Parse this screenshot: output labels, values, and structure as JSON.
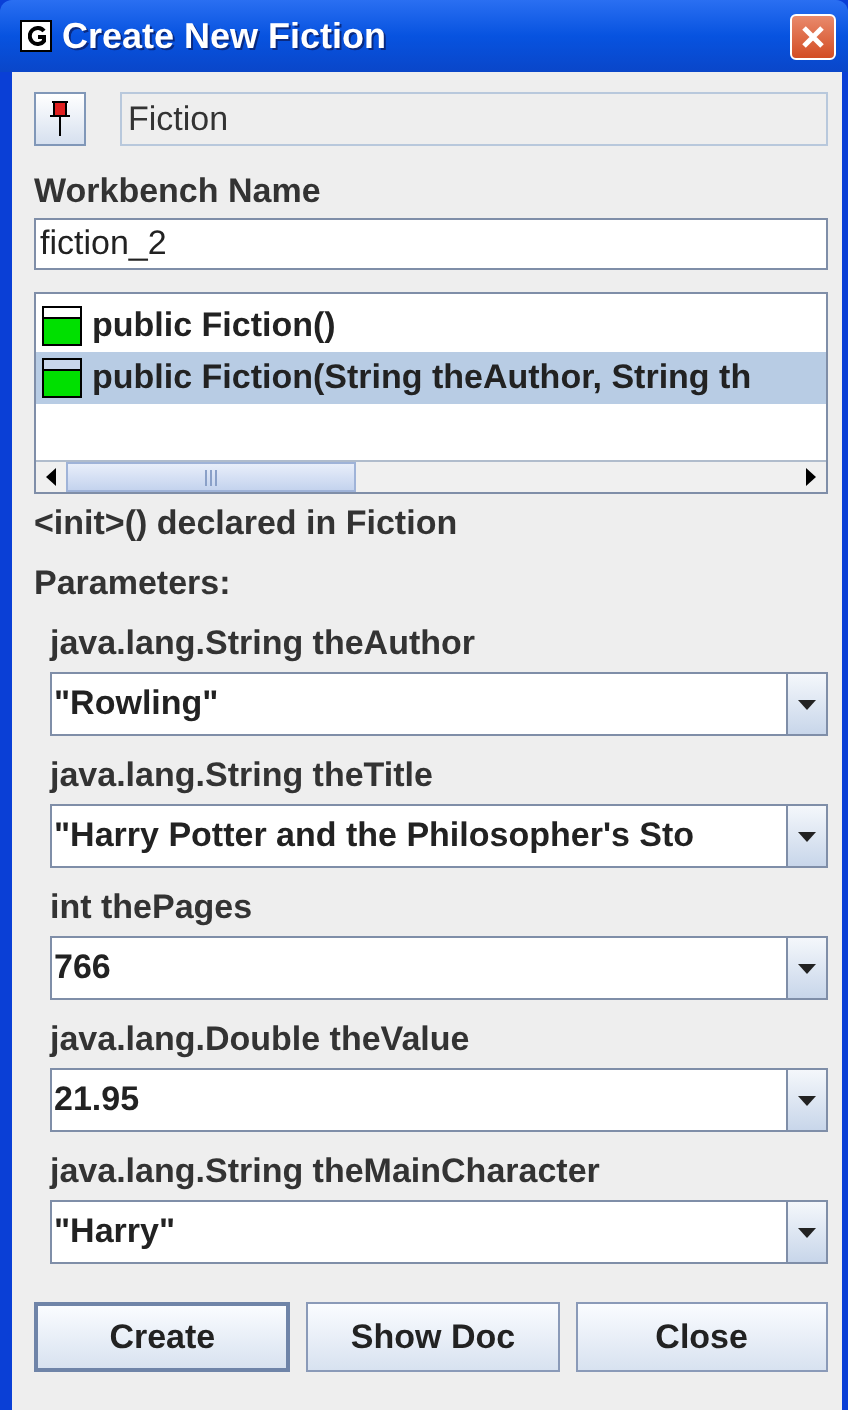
{
  "window": {
    "title": "Create New Fiction"
  },
  "class_name": "Fiction",
  "workbench_name": {
    "label": "Workbench Name",
    "value": "fiction_2"
  },
  "constructors": [
    {
      "signature": "public Fiction()",
      "selected": false
    },
    {
      "signature": "public Fiction(String theAuthor, String th",
      "selected": true
    }
  ],
  "description": "<init>() declared in Fiction",
  "parameters_label": "Parameters:",
  "parameters": [
    {
      "label": "java.lang.String theAuthor",
      "value": "\"Rowling\""
    },
    {
      "label": "java.lang.String theTitle",
      "value": "\"Harry Potter and the Philosopher's Sto"
    },
    {
      "label": "int thePages",
      "value": "766"
    },
    {
      "label": "java.lang.Double theValue",
      "value": "21.95"
    },
    {
      "label": "java.lang.String theMainCharacter",
      "value": "\"Harry\""
    }
  ],
  "buttons": [
    {
      "label": "Create",
      "default": true
    },
    {
      "label": "Show Doc",
      "default": false
    },
    {
      "label": "Close",
      "default": false
    }
  ]
}
